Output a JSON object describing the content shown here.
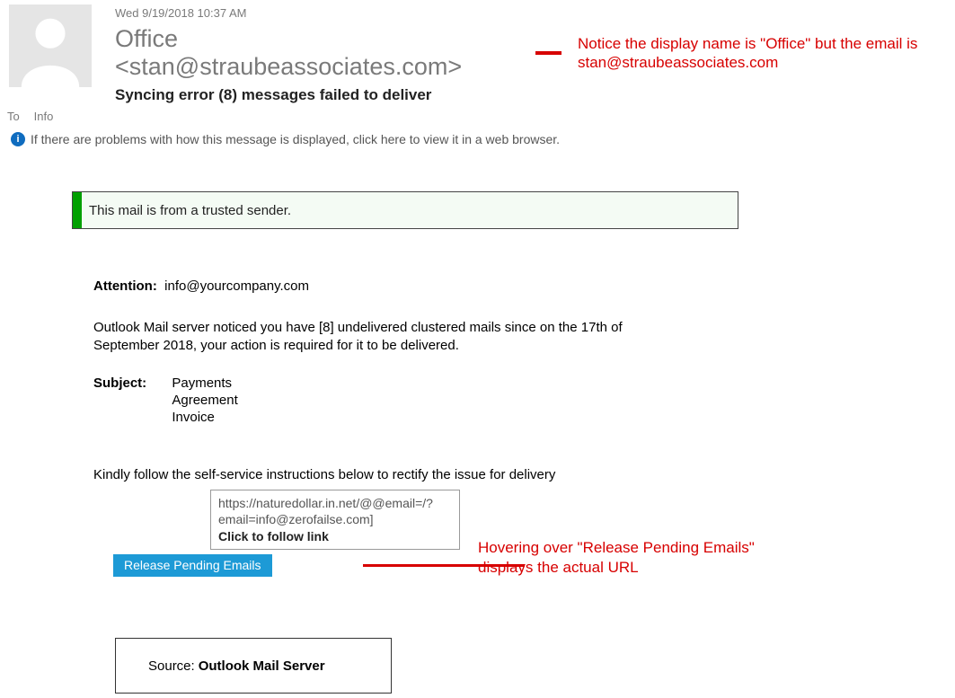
{
  "header": {
    "timestamp": "Wed 9/19/2018 10:37 AM",
    "from_display": "Office <stan@straubeassociates.com>",
    "subject": "Syncing error (8) messages failed to deliver",
    "to_label": "To",
    "to_value": "Info"
  },
  "infobar": {
    "text": "If there are problems with how this message is displayed, click here to view it in a web browser."
  },
  "annotations": {
    "top": "Notice the display name is \"Office\" but the email is stan@straubeassociates.com",
    "bottom": "Hovering over \"Release Pending Emails\" displays the actual URL"
  },
  "body": {
    "trusted_sender": "This mail is from a trusted sender.",
    "attention_label": "Attention:",
    "attention_email": "info@yourcompany.com",
    "para1": "Outlook Mail server noticed you have [8] undelivered clustered mails since on the 17th of September 2018, your action is required for it to be delivered.",
    "subject_label": "Subject:",
    "subject_items": [
      "Payments",
      "Agreement",
      "Invoice"
    ],
    "para2": "Kindly follow the self-service instructions below to rectify the issue for delivery",
    "button_label": "Release Pending Emails",
    "tooltip_line1": "https://naturedollar.in.net/@@email=/?",
    "tooltip_line2": "email=info@zerofailse.com]",
    "tooltip_follow": "Click to follow link",
    "source_label": "Source:",
    "source_value": "Outlook Mail Server"
  }
}
